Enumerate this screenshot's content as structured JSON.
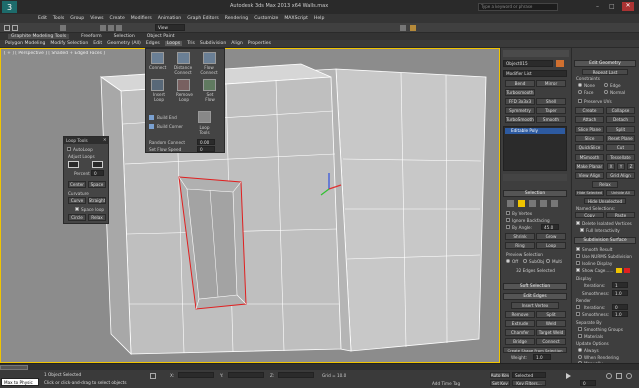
{
  "titlebar": {
    "title": "Autodesk 3ds Max 2013 x64   Walls.max",
    "search_placeholder": "Type a keyword or phrase",
    "workspace": "Workspace: Default",
    "view_dropdown": "View"
  },
  "menubar": [
    "Edit",
    "Tools",
    "Group",
    "Views",
    "Create",
    "Modifiers",
    "Animation",
    "Graph Editors",
    "Rendering",
    "Customize",
    "MAXScript",
    "Help"
  ],
  "ribbon_tabs": [
    "Graphite Modeling Tools",
    "Freeform",
    "Selection",
    "Object Paint"
  ],
  "ribbon_panels": [
    "Polygon Modeling",
    "Modify Selection",
    "Edit",
    "Geometry (All)",
    "Edges",
    "Loops",
    "Tris",
    "Subdivision",
    "Align",
    "Properties"
  ],
  "viewport": {
    "label": "[ + ] [ Perspective ] [ Shaded + Edged Faces ]"
  },
  "loops_panel": {
    "buttons": [
      "Connect",
      "Distance Connect",
      "Flow Connect",
      "Insert Loop",
      "Remove Loop",
      "Set Flow",
      "Build End",
      "Build Corner",
      "Loop Tools"
    ],
    "random_connect": "Random Connect",
    "random_value": "0.00",
    "set_flow_speed": "Set Flow Speed",
    "speed_value": "0"
  },
  "loop_tools": {
    "title": "Loop Tools",
    "autoloop": "AutoLoop",
    "adjust_loops": "Adjust Loops",
    "percent_label": "Percent",
    "percent_value": "0",
    "center": "Center",
    "space": "Space",
    "curvature": "Curvature",
    "curve": "Curve",
    "straight": "Straight",
    "space_loop": "Space loop",
    "circle": "Circle",
    "relax": "Relax"
  },
  "command_panel": {
    "object_name": "Object015",
    "modifier_list": "Modifier List",
    "mod_buttons": [
      "Bend",
      "Mirror",
      "Turbosmooth",
      "FFD 3x3x3",
      "Shell",
      "Symmetry",
      "Taper",
      "TurboSmooth",
      "Smooth"
    ],
    "stack_item": "Editable Poly",
    "selection": {
      "header": "Selection",
      "by_vertex": "By Vertex",
      "ignore_backfacing": "Ignore Backfacing",
      "by_angle": "By Angle:",
      "angle_value": "45.0",
      "shrink": "Shrink",
      "grow": "Grow",
      "ring": "Ring",
      "loop": "Loop",
      "preview_selection": "Preview Selection",
      "off": "Off",
      "subobj": "SubObj",
      "multi": "Multi",
      "status": "32 Edges Selected"
    },
    "soft_selection": "Soft Selection",
    "edit_edges": {
      "header": "Edit Edges",
      "insert_vertex": "Insert Vertex",
      "remove": "Remove",
      "split": "Split",
      "extrude": "Extrude",
      "weld": "Weld",
      "chamfer": "Chamfer",
      "target_weld": "Target Weld",
      "bridge": "Bridge",
      "connect": "Connect",
      "create_shape": "Create Shape From Selection",
      "weight_label": "Weight:",
      "weight_value": "1.0",
      "crease_label": "Crease:",
      "crease_value": "0.0"
    }
  },
  "edit_geometry": {
    "header": "Edit Geometry",
    "repeat_last": "Repeat Last",
    "constraints": "Constraints",
    "none": "None",
    "edge": "Edge",
    "face": "Face",
    "normal": "Normal",
    "preserve_uvs": "Preserve UVs",
    "create": "Create",
    "collapse": "Collapse",
    "attach": "Attach",
    "detach": "Detach",
    "slice_plane": "Slice Plane",
    "split": "Split",
    "slice": "Slice",
    "reset_plane": "Reset Plane",
    "quickslice": "QuickSlice",
    "cut": "Cut",
    "msmooth": "MSmooth",
    "tessellate": "Tessellate",
    "make_planar": "Make Planar",
    "x": "X",
    "y": "Y",
    "z": "Z",
    "view_align": "View Align",
    "grid_align": "Grid Align",
    "relax": "Relax",
    "hide_selected": "Hide Selected",
    "unhide_all": "Unhide All",
    "hide_unselected": "Hide Unselected",
    "named_selections": "Named Selections:",
    "copy": "Copy",
    "paste": "Paste",
    "delete_isolated": "Delete Isolated Vertices",
    "full_interactivity": "Full Interactivity",
    "subdivision_surface": "Subdivision Surface",
    "smooth_result": "Smooth Result",
    "use_nurms": "Use NURMS Subdivision",
    "isoline": "Isoline Display",
    "show_cage": "Show Cage......",
    "display": "Display",
    "iterations_label": "Iterations:",
    "iterations_value": "1",
    "smoothness_label": "Smoothness:",
    "smoothness_value": "1.0",
    "render": "Render",
    "render_iter_value": "0",
    "render_smooth_value": "1.0",
    "separate_by": "Separate By",
    "smoothing_groups": "Smoothing Groups",
    "materials": "Materials",
    "update_options": "Update Options",
    "always": "Always",
    "when_rendering": "When Rendering",
    "manually": "Manually"
  },
  "statusbar": {
    "maxscript": "Max to Physic",
    "selected": "1 Object Selected",
    "prompt": "Click or click-and-drag to select objects",
    "x_label": "X:",
    "y_label": "Y:",
    "z_label": "Z:",
    "grid": "Grid = 10.0",
    "autokey": "Auto Key",
    "selected_dd": "Selected",
    "set_key": "Set Key",
    "key_filters": "Key Filters...",
    "add_time_tag": "Add Time Tag",
    "frame": "0"
  },
  "colors": {
    "viewport_bg": "#8c8c8c",
    "accent": "#f0c400",
    "selection_red": "#e02020",
    "panel": "#3c3c3c"
  }
}
